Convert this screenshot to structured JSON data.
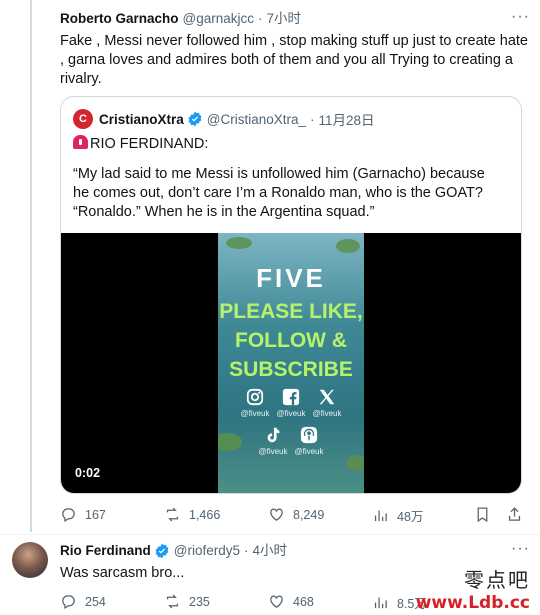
{
  "tweet1": {
    "name": "Roberto Garnacho",
    "handle": "@garnakjcc",
    "time": "7小时",
    "text": "Fake , Messi never followed him , stop making stuff up just to create hate , garna loves and admires both of them and you all Trying to creating a rivalry.",
    "quote": {
      "name": "CristianoXtra",
      "handle": "@CristianoXtra_",
      "time": "11月28日",
      "line1": "RIO FERDINAND:",
      "line2": "“My lad said to me Messi is unfollowed him (Garnacho) because he comes out, don’t care I’m a Ronaldo man, who is the GOAT? “Ronaldo.” When he is in the Argentina squad.”",
      "video": {
        "brand": "FIVE",
        "cta": [
          "PLEASE LIKE,",
          "FOLLOW &",
          "SUBSCRIBE"
        ],
        "socials": [
          {
            "icon": "instagram-icon",
            "label": "@fiveuk"
          },
          {
            "icon": "facebook-icon",
            "label": "@fiveuk"
          },
          {
            "icon": "x-icon",
            "label": "@fiveuk"
          },
          {
            "icon": "tiktok-icon",
            "label": "@fiveuk"
          },
          {
            "icon": "podcast-icon",
            "label": "@fiveuk"
          }
        ],
        "timestamp": "0:02"
      }
    },
    "actions": {
      "replies": "167",
      "reposts": "1,466",
      "likes": "8,249",
      "views": "48万"
    }
  },
  "tweet2": {
    "name": "Rio Ferdinand",
    "handle": "@rioferdy5",
    "time": "4小时",
    "text": "Was sarcasm bro...",
    "actions": {
      "replies": "254",
      "reposts": "235",
      "likes": "468",
      "views": "8.5万"
    }
  },
  "watermark": {
    "cn": "零点吧",
    "url": "www.Ldb.cc"
  },
  "colors": {
    "text": "#0f1419",
    "muted": "#536471",
    "border": "#cfd9de",
    "verified": "#1d9bf0",
    "brandGreen": "#b6f36b"
  }
}
